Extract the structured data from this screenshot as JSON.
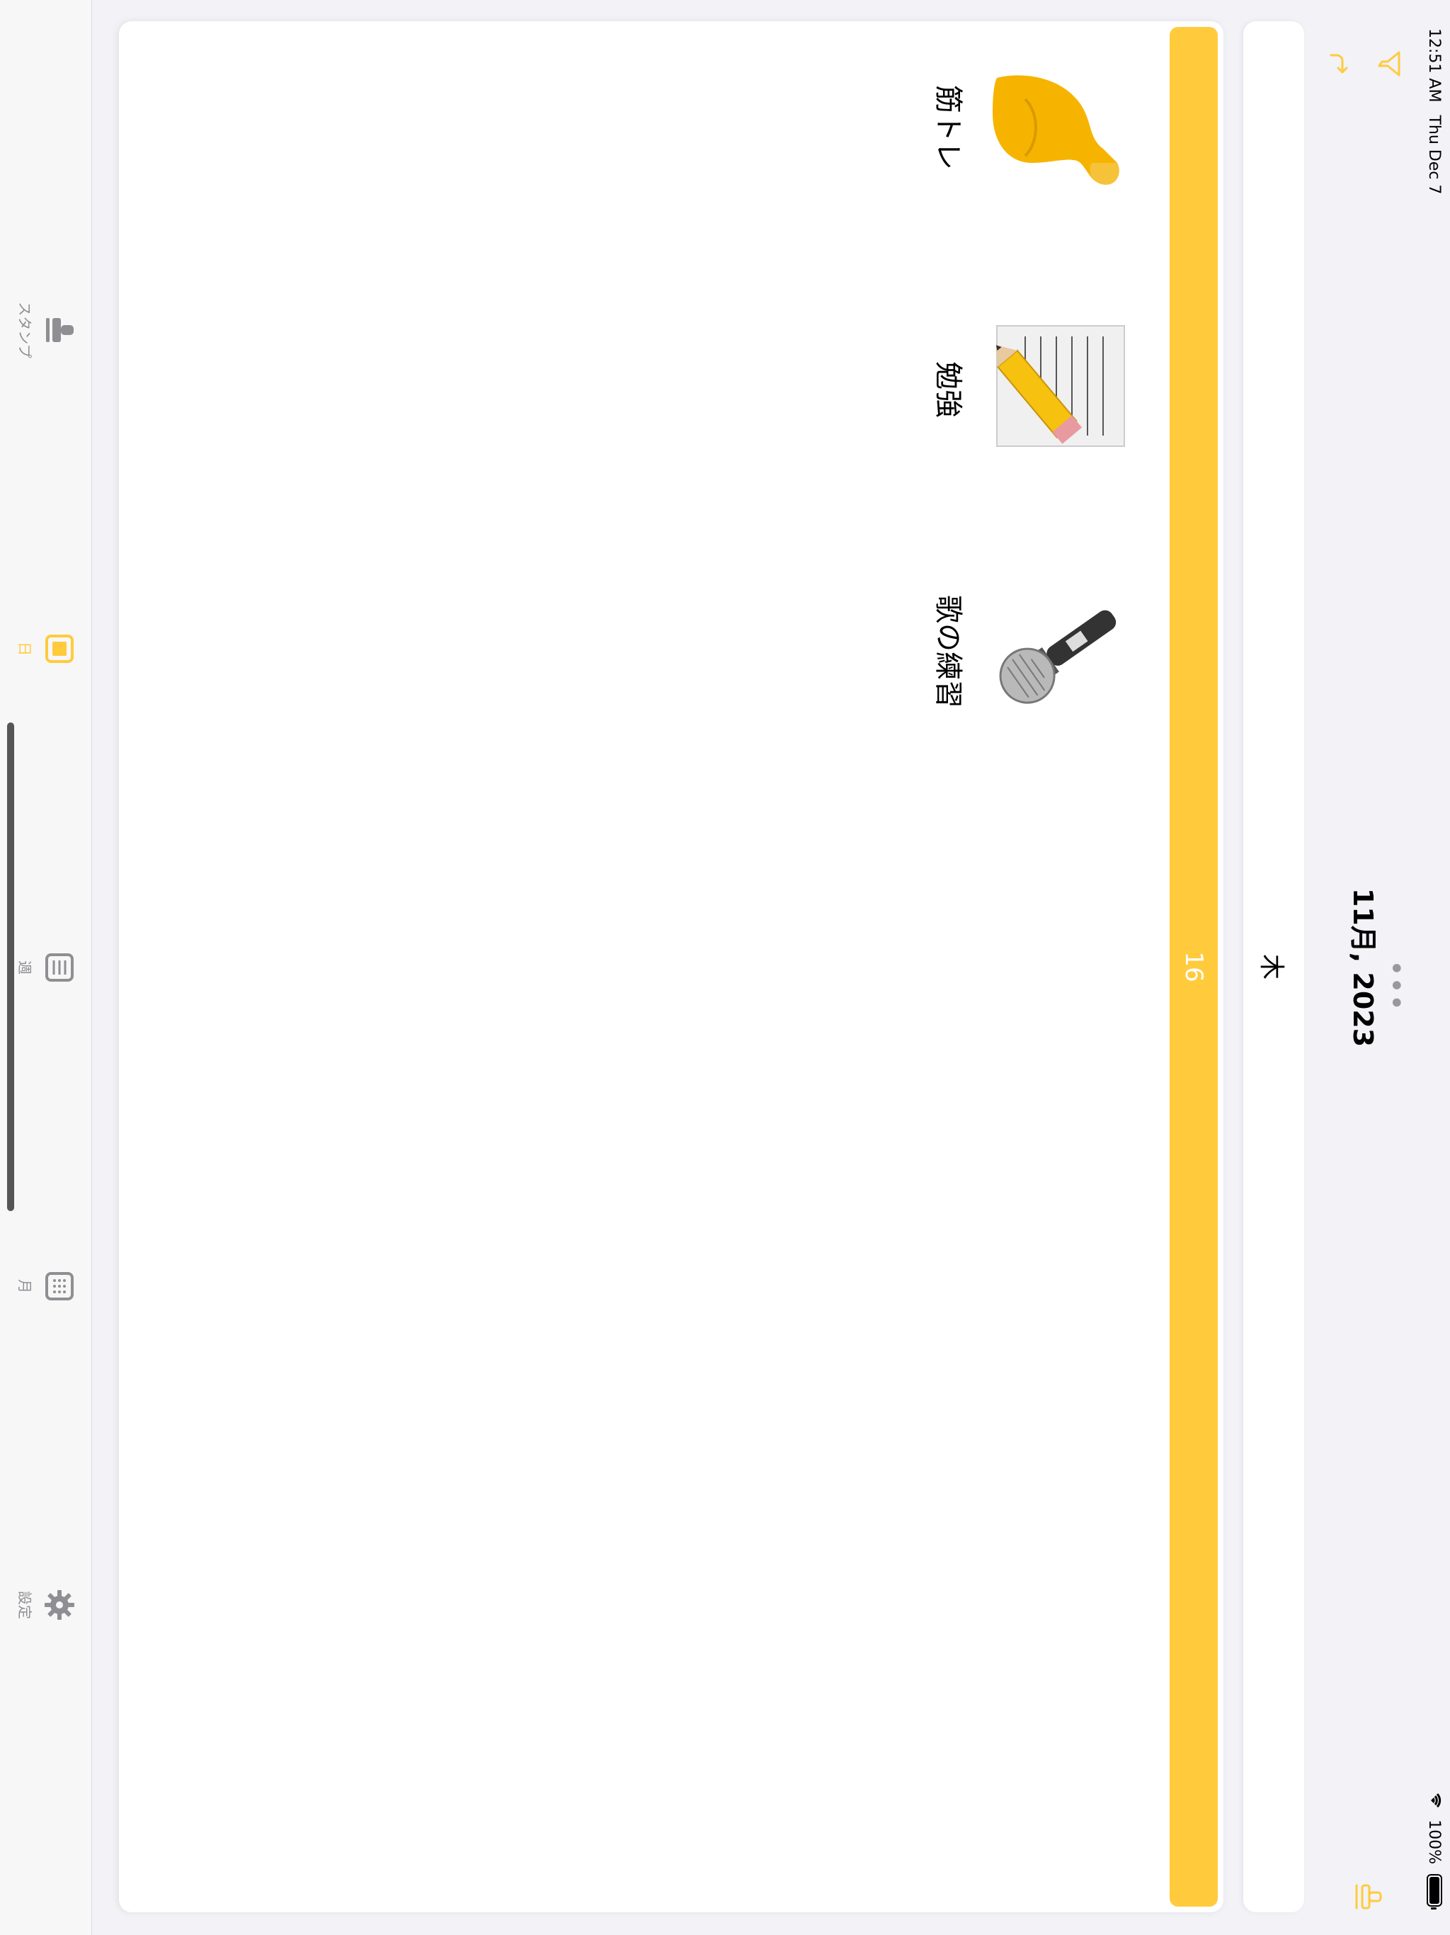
{
  "status_bar": {
    "time": "12:51 AM",
    "date": "Thu Dec 7",
    "battery": "100%"
  },
  "nav": {
    "title": "11月, 2023",
    "more_icon": "ellipsis-icon",
    "filter_icon": "filter-icon",
    "redo_icon": "redo-arrow-icon",
    "stamp_icon": "stamp-icon"
  },
  "day_header": {
    "weekday": "木"
  },
  "day_card": {
    "date_number": "16",
    "stamps": [
      {
        "label": "筋トレ",
        "icon": "flexed-biceps-icon"
      },
      {
        "label": "勉強",
        "icon": "memo-pencil-icon"
      },
      {
        "label": "歌の練習",
        "icon": "microphone-icon"
      }
    ]
  },
  "tab_bar": {
    "tabs": [
      {
        "label": "スタンプ",
        "icon": "stamp-icon",
        "active": false
      },
      {
        "label": "日",
        "icon": "day-view-icon",
        "active": true
      },
      {
        "label": "週",
        "icon": "week-view-icon",
        "active": false
      },
      {
        "label": "月",
        "icon": "month-grid-icon",
        "active": false
      },
      {
        "label": "設定",
        "icon": "gear-icon",
        "active": false
      }
    ]
  },
  "colors": {
    "accent": "#ffcb3d",
    "inactive": "#8e8e93"
  }
}
